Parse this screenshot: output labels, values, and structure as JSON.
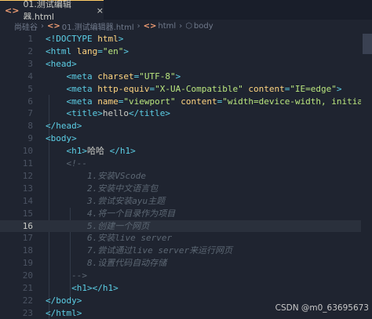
{
  "tab": {
    "icon": "html-file-icon",
    "icon_text": "<>",
    "label": "01.测试编辑器.html",
    "close_glyph": "×"
  },
  "breadcrumb": {
    "root": "尚硅谷",
    "sep": "›",
    "file_icon_text": "<>",
    "file": "01.测试编辑器.html",
    "html_icon_text": "<>",
    "html": "html",
    "body_icon_glyph": "⬡",
    "body": "body"
  },
  "editor": {
    "active_line": 16,
    "lines": [
      {
        "n": "1",
        "tokens": [
          {
            "t": "punc",
            "v": "<!"
          },
          {
            "t": "tag",
            "v": "DOCTYPE"
          },
          {
            "t": "text",
            "v": " "
          },
          {
            "t": "attr",
            "v": "html"
          },
          {
            "t": "punc",
            "v": ">"
          }
        ]
      },
      {
        "n": "2",
        "tokens": [
          {
            "t": "punc",
            "v": "<"
          },
          {
            "t": "tag",
            "v": "html"
          },
          {
            "t": "text",
            "v": " "
          },
          {
            "t": "attr",
            "v": "lang"
          },
          {
            "t": "punc",
            "v": "="
          },
          {
            "t": "str",
            "v": "\"en\""
          },
          {
            "t": "punc",
            "v": ">"
          }
        ]
      },
      {
        "n": "3",
        "tokens": [
          {
            "t": "punc",
            "v": "<"
          },
          {
            "t": "tag",
            "v": "head"
          },
          {
            "t": "punc",
            "v": ">"
          }
        ]
      },
      {
        "n": "4",
        "tokens": [
          {
            "t": "text",
            "v": "    "
          },
          {
            "t": "punc",
            "v": "<"
          },
          {
            "t": "tag",
            "v": "meta"
          },
          {
            "t": "text",
            "v": " "
          },
          {
            "t": "attr",
            "v": "charset"
          },
          {
            "t": "punc",
            "v": "="
          },
          {
            "t": "str",
            "v": "\"UTF-8\""
          },
          {
            "t": "punc",
            "v": ">"
          }
        ]
      },
      {
        "n": "5",
        "tokens": [
          {
            "t": "text",
            "v": "    "
          },
          {
            "t": "punc",
            "v": "<"
          },
          {
            "t": "tag",
            "v": "meta"
          },
          {
            "t": "text",
            "v": " "
          },
          {
            "t": "attr",
            "v": "http-equiv"
          },
          {
            "t": "punc",
            "v": "="
          },
          {
            "t": "str",
            "v": "\"X-UA-Compatible\""
          },
          {
            "t": "text",
            "v": " "
          },
          {
            "t": "attr",
            "v": "content"
          },
          {
            "t": "punc",
            "v": "="
          },
          {
            "t": "str",
            "v": "\"IE=edge\""
          },
          {
            "t": "punc",
            "v": ">"
          }
        ]
      },
      {
        "n": "6",
        "tokens": [
          {
            "t": "text",
            "v": "    "
          },
          {
            "t": "punc",
            "v": "<"
          },
          {
            "t": "tag",
            "v": "meta"
          },
          {
            "t": "text",
            "v": " "
          },
          {
            "t": "attr",
            "v": "name"
          },
          {
            "t": "punc",
            "v": "="
          },
          {
            "t": "str",
            "v": "\"viewport\""
          },
          {
            "t": "text",
            "v": " "
          },
          {
            "t": "attr",
            "v": "content"
          },
          {
            "t": "punc",
            "v": "="
          },
          {
            "t": "str",
            "v": "\"width=device-width, initial"
          }
        ]
      },
      {
        "n": "7",
        "tokens": [
          {
            "t": "text",
            "v": "    "
          },
          {
            "t": "punc",
            "v": "<"
          },
          {
            "t": "tag",
            "v": "title"
          },
          {
            "t": "punc",
            "v": ">"
          },
          {
            "t": "text",
            "v": "hello"
          },
          {
            "t": "punc",
            "v": "</"
          },
          {
            "t": "tag",
            "v": "title"
          },
          {
            "t": "punc",
            "v": ">"
          }
        ]
      },
      {
        "n": "8",
        "tokens": [
          {
            "t": "punc",
            "v": "</"
          },
          {
            "t": "tag",
            "v": "head"
          },
          {
            "t": "punc",
            "v": ">"
          }
        ]
      },
      {
        "n": "9",
        "tokens": [
          {
            "t": "punc",
            "v": "<"
          },
          {
            "t": "tag",
            "v": "body"
          },
          {
            "t": "punc",
            "v": ">"
          }
        ]
      },
      {
        "n": "10",
        "tokens": [
          {
            "t": "text",
            "v": "    "
          },
          {
            "t": "punc",
            "v": "<"
          },
          {
            "t": "tag",
            "v": "h1"
          },
          {
            "t": "punc",
            "v": ">"
          },
          {
            "t": "text",
            "v": "哈哈 "
          },
          {
            "t": "punc",
            "v": "</"
          },
          {
            "t": "tag",
            "v": "h1"
          },
          {
            "t": "punc",
            "v": ">"
          }
        ]
      },
      {
        "n": "11",
        "tokens": [
          {
            "t": "text",
            "v": "    "
          },
          {
            "t": "cmt",
            "v": "<!--"
          }
        ]
      },
      {
        "n": "12",
        "tokens": [
          {
            "t": "text",
            "v": "        "
          },
          {
            "t": "cmt",
            "v": "1.安装VScode"
          }
        ]
      },
      {
        "n": "13",
        "tokens": [
          {
            "t": "text",
            "v": "        "
          },
          {
            "t": "cmt",
            "v": "2.安装中文语言包"
          }
        ]
      },
      {
        "n": "14",
        "tokens": [
          {
            "t": "text",
            "v": "        "
          },
          {
            "t": "cmt",
            "v": "3.尝试安装ayu主题"
          }
        ]
      },
      {
        "n": "15",
        "tokens": [
          {
            "t": "text",
            "v": "        "
          },
          {
            "t": "cmt",
            "v": "4.将一个目录作为项目"
          }
        ]
      },
      {
        "n": "16",
        "tokens": [
          {
            "t": "text",
            "v": "        "
          },
          {
            "t": "cmt",
            "v": "5.创建一个网页"
          }
        ]
      },
      {
        "n": "17",
        "tokens": [
          {
            "t": "text",
            "v": "        "
          },
          {
            "t": "cmt",
            "v": "6.安装live server"
          }
        ]
      },
      {
        "n": "18",
        "tokens": [
          {
            "t": "text",
            "v": "        "
          },
          {
            "t": "cmt",
            "v": "7.尝试通过live server来运行网页"
          }
        ]
      },
      {
        "n": "19",
        "tokens": [
          {
            "t": "text",
            "v": "        "
          },
          {
            "t": "cmt",
            "v": "8.设置代码自动存储"
          }
        ]
      },
      {
        "n": "20",
        "tokens": [
          {
            "t": "text",
            "v": "     "
          },
          {
            "t": "cmt",
            "v": "-->"
          }
        ]
      },
      {
        "n": "21",
        "tokens": [
          {
            "t": "text",
            "v": "     "
          },
          {
            "t": "punc",
            "v": "<"
          },
          {
            "t": "tag",
            "v": "h1"
          },
          {
            "t": "punc",
            "v": "></"
          },
          {
            "t": "tag",
            "v": "h1"
          },
          {
            "t": "punc",
            "v": ">"
          }
        ]
      },
      {
        "n": "22",
        "tokens": [
          {
            "t": "punc",
            "v": "</"
          },
          {
            "t": "tag",
            "v": "body"
          },
          {
            "t": "punc",
            "v": ">"
          }
        ]
      },
      {
        "n": "23",
        "tokens": [
          {
            "t": "punc",
            "v": "</"
          },
          {
            "t": "tag",
            "v": "html"
          },
          {
            "t": "punc",
            "v": ">"
          }
        ]
      }
    ]
  },
  "watermark": "CSDN @m0_63695673",
  "colors": {
    "background": "#1f2430",
    "tag": "#5ccfe6",
    "attribute": "#ffd580",
    "string": "#bae67e",
    "comment": "#5c6773",
    "text": "#cbccc6",
    "accent": "#ffcc66"
  }
}
